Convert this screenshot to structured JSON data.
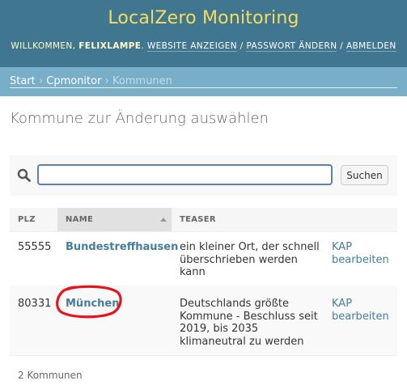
{
  "header": {
    "branding": "LocalZero Monitoring",
    "welcome": "WILLKOMMEN,",
    "username": "FELIXLAMPE",
    "links": [
      "WEBSITE ANZEIGEN",
      "PASSWORT ÄNDERN",
      "ABMELDEN"
    ],
    "separator": "/"
  },
  "breadcrumbs": {
    "items": [
      "Start",
      "Cpmonitor",
      "Kommunen"
    ],
    "separator": "›"
  },
  "page": {
    "title": "Kommune zur Änderung auswählen"
  },
  "search": {
    "value": "",
    "button_label": "Suchen"
  },
  "table": {
    "columns": [
      "PLZ",
      "NAME",
      "TEASER",
      ""
    ],
    "sorted_column": "NAME",
    "rows": [
      {
        "plz": "55555",
        "name": "Bundestreffhausen",
        "teaser_lines": [
          "ein kleiner Ort, der schnell",
          "überschrieben werden",
          "kann"
        ],
        "action_lines": [
          "KAP",
          "bearbeiten"
        ]
      },
      {
        "plz": "80331",
        "name": "München",
        "teaser_lines": [
          "Deutschlands größte",
          "Kommune - Beschluss seit",
          "2019, bis 2035",
          "klimaneutral zu werden"
        ],
        "action_lines": [
          "KAP",
          "bearbeiten"
        ]
      }
    ]
  },
  "paginator": {
    "text": "2 Kommunen"
  },
  "colors": {
    "header_bg": "#417690",
    "branding": "#f5dd5d",
    "breadcrumb_bg": "#79aec8",
    "link": "#447e9b",
    "annotation": "#e8141c"
  }
}
